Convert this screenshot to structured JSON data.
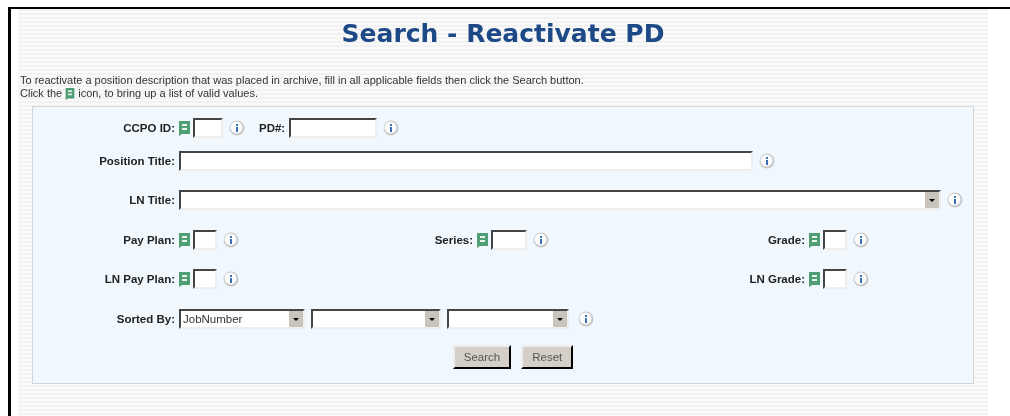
{
  "title": "Search - Reactivate PD",
  "instructions": {
    "line1": "To reactivate a position description that was placed in archive, fill in all applicable fields then click the Search button.",
    "line2_before": "Click the",
    "line2_after": "icon, to bring up a list of valid values."
  },
  "ccpo_id": {
    "label": "CCPO ID:",
    "lookup": true
  },
  "pd_number": {
    "label": "PD#:"
  },
  "position_title": {
    "label": "Position Title:"
  },
  "ln_title": {
    "label": "LN Title:"
  },
  "pay_plan": {
    "label": "Pay Plan:",
    "lookup": true
  },
  "series": {
    "label": "Series:",
    "lookup": true
  },
  "grade": {
    "label": "Grade:",
    "lookup": true
  },
  "ln_pay_plan": {
    "label": "LN Pay Plan:",
    "lookup": true
  },
  "ln_grade": {
    "label": "LN Grade:",
    "lookup": true
  },
  "sorted_by": {
    "label": "Sorted By:",
    "selects": [
      {
        "kind": "dropdown",
        "value": "JobNumber"
      },
      {
        "kind": "dropdown"
      },
      {
        "kind": "dropdown"
      }
    ]
  },
  "buttons": [
    "Search",
    "Reset"
  ]
}
